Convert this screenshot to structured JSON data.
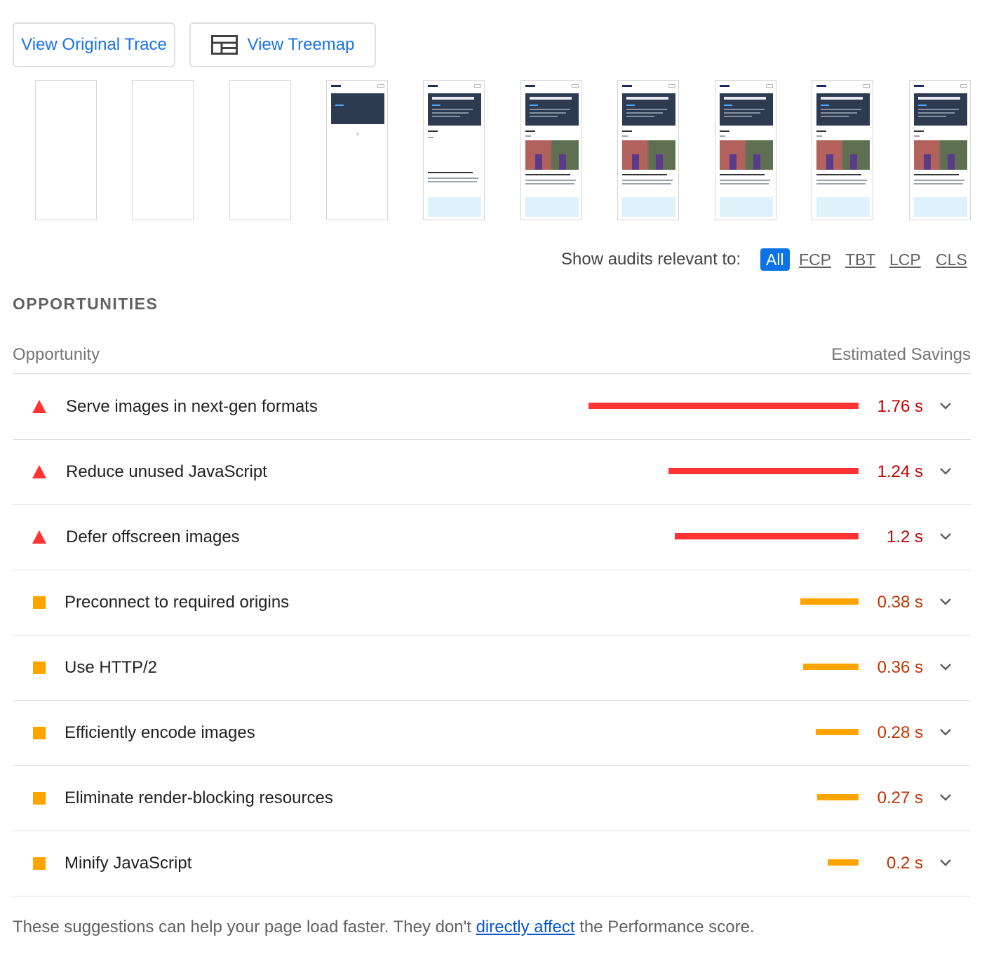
{
  "toolbar": {
    "view_trace_label": "View Original Trace",
    "view_treemap_label": "View Treemap"
  },
  "filter": {
    "label": "Show audits relevant to:",
    "chips": [
      "All",
      "FCP",
      "TBT",
      "LCP",
      "CLS"
    ],
    "active": "All"
  },
  "section": {
    "title": "OPPORTUNITIES",
    "col_opportunity": "Opportunity",
    "col_savings": "Estimated Savings"
  },
  "colors": {
    "fail": "#ff3333",
    "average": "#ffa400",
    "link": "#1a73e8"
  },
  "opportunities": [
    {
      "title": "Serve images in next-gen formats",
      "savings": "1.76 s",
      "seconds": 1.76,
      "rating": "fail",
      "icon": "warning-triangle-icon"
    },
    {
      "title": "Reduce unused JavaScript",
      "savings": "1.24 s",
      "seconds": 1.24,
      "rating": "fail",
      "icon": "warning-triangle-icon"
    },
    {
      "title": "Defer offscreen images",
      "savings": "1.2 s",
      "seconds": 1.2,
      "rating": "fail",
      "icon": "warning-triangle-icon"
    },
    {
      "title": "Preconnect to required origins",
      "savings": "0.38 s",
      "seconds": 0.38,
      "rating": "average",
      "icon": "average-square-icon"
    },
    {
      "title": "Use HTTP/2",
      "savings": "0.36 s",
      "seconds": 0.36,
      "rating": "average",
      "icon": "average-square-icon"
    },
    {
      "title": "Efficiently encode images",
      "savings": "0.28 s",
      "seconds": 0.28,
      "rating": "average",
      "icon": "average-square-icon"
    },
    {
      "title": "Eliminate render-blocking resources",
      "savings": "0.27 s",
      "seconds": 0.27,
      "rating": "average",
      "icon": "average-square-icon"
    },
    {
      "title": "Minify JavaScript",
      "savings": "0.2 s",
      "seconds": 0.2,
      "rating": "average",
      "icon": "average-square-icon"
    }
  ],
  "footer": {
    "before": "These suggestions can help your page load faster. They don't ",
    "link": "directly affect",
    "after": " the Performance score."
  }
}
